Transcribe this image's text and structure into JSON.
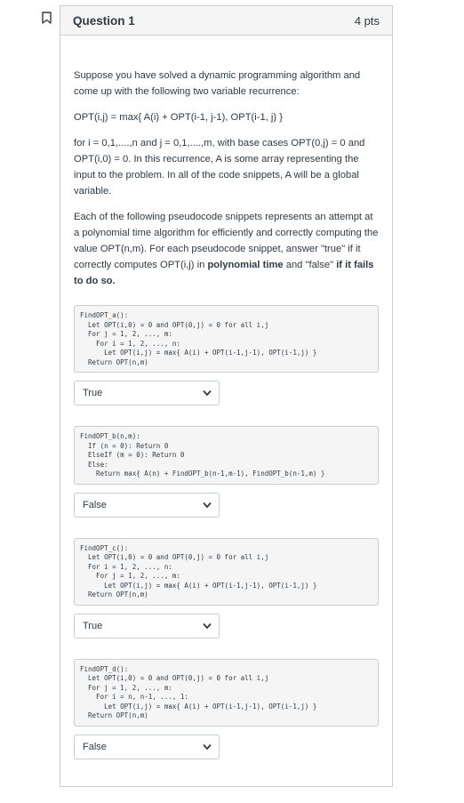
{
  "question": {
    "title": "Question 1",
    "points": "4 pts"
  },
  "intro": {
    "p1": "Suppose you have solved a dynamic programming algorithm and come up with the following two variable recurrence:",
    "recurrence": "OPT(i,j) = max{ A(i) + OPT(i-1, j-1), OPT(i-1, j) }",
    "p3": "for i = 0,1,....,n and j = 0,1,....,m, with base cases OPT(0,j) = 0 and OPT(i,0) = 0.  In this recurrence, A is some array representing the input to the problem.  In all of the code snippets, A will be a global variable.",
    "p4_a": "Each of the following pseudocode snippets represents an attempt at a polynomial time algorithm for efficiently and correctly computing the value OPT(n,m).  For each pseudocode snippet, answer \"true\" if it correctly computes OPT(i,j) in ",
    "p4_b": "polynomial time",
    "p4_c": " and \"false\" ",
    "p4_d": "if it fails to do so."
  },
  "snippets": [
    {
      "code": "FindOPT_a():\n  Let OPT(i,0) = 0 and OPT(0,j) = 0 for all i,j\n  For j = 1, 2, ..., m:\n    For i = 1, 2, ..., n:\n      Let OPT(i,j) = max{ A(i) + OPT(i-1,j-1), OPT(i-1,j) }\n  Return OPT(n,m)",
      "answer": "True"
    },
    {
      "code": "FindOPT_b(n,m):\n  If (n = 0): Return 0\n  ElseIf (m = 0): Return 0\n  Else:\n    Return max{ A(n) + FindOPT_b(n-1,m-1), FindOPT_b(n-1,m) }",
      "answer": "False"
    },
    {
      "code": "FindOPT_c():\n  Let OPT(i,0) = 0 and OPT(0,j) = 0 for all i,j\n  For i = 1, 2, ..., n:\n    For j = 1, 2, ..., m:\n      Let OPT(i,j) = max{ A(i) + OPT(i-1,j-1), OPT(i-1,j) }\n  Return OPT(n,m)",
      "answer": "True"
    },
    {
      "code": "FindOPT_d():\n  Let OPT(i,0) = 0 and OPT(0,j) = 0 for all i,j\n  For j = 1, 2, ..., m:\n    For i = n, n-1, ..., 1:\n      Let OPT(i,j) = max{ A(i) + OPT(i-1,j-1), OPT(i-1,j) }\n  Return OPT(n,m)",
      "answer": "False"
    }
  ],
  "icons": {
    "flag": "bookmark-flag-icon",
    "chevron": "chevron-down-icon"
  },
  "colors": {
    "text": "#2d3b45",
    "border": "#c7cdd1",
    "header_bg": "#f5f5f5",
    "flag": "#2d3b45"
  }
}
